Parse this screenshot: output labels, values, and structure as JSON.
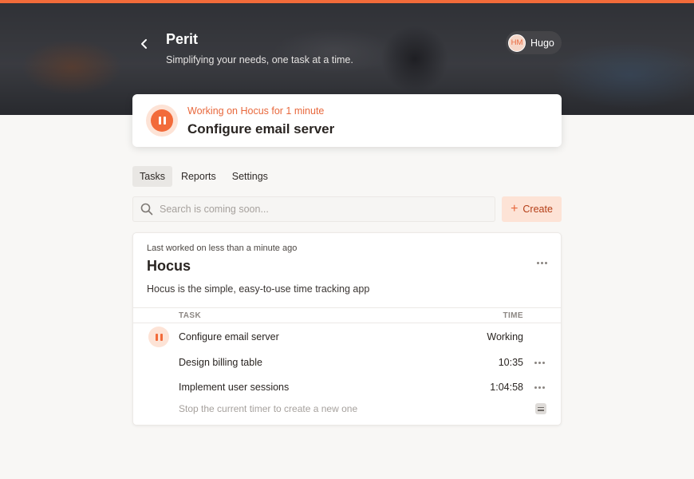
{
  "header": {
    "app_title": "Perit",
    "app_subtitle": "Simplifying your needs, one task at a time.",
    "user": {
      "initials": "HM",
      "name": "Hugo"
    }
  },
  "current": {
    "status": "Working on Hocus for 1 minute",
    "task": "Configure email server"
  },
  "tabs": [
    {
      "label": "Tasks",
      "active": true
    },
    {
      "label": "Reports",
      "active": false
    },
    {
      "label": "Settings",
      "active": false
    }
  ],
  "search": {
    "placeholder": "Search is coming soon..."
  },
  "create_label": "Create",
  "project": {
    "last_worked": "Last worked on less than a minute ago",
    "name": "Hocus",
    "description": "Hocus is the simple, easy-to-use time tracking app",
    "columns": {
      "task": "TASK",
      "time": "TIME"
    },
    "tasks": [
      {
        "name": "Configure email server",
        "time": "Working",
        "active": true
      },
      {
        "name": "Design billing table",
        "time": "10:35",
        "active": false
      },
      {
        "name": "Implement user sessions",
        "time": "1:04:58",
        "active": false
      }
    ],
    "hint": "Stop the current timer to create a new one"
  },
  "colors": {
    "accent": "#f26b3a",
    "accent_soft": "#fde3d6"
  }
}
